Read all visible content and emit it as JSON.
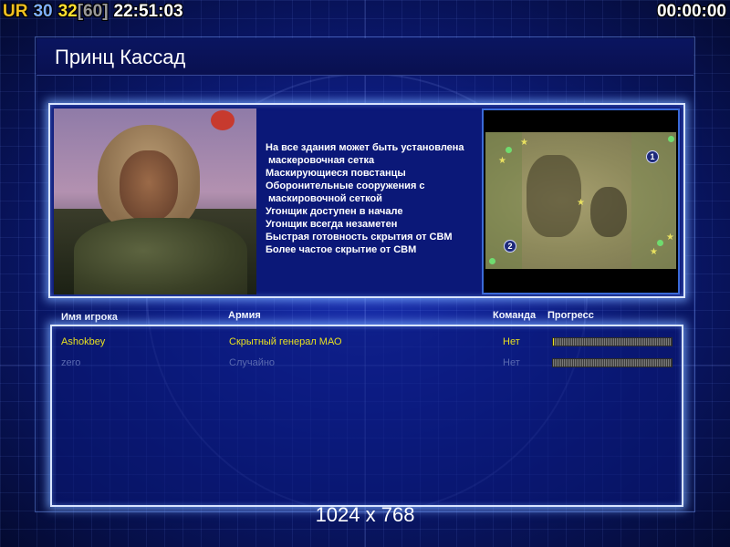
{
  "hud": {
    "ur": "UR",
    "fps": "30",
    "fps_current": "32",
    "fps_limit": "[60]",
    "clock": "22:51:03",
    "timer": "00:00:00"
  },
  "title": "Принц Кассад",
  "traits": [
    "На все здания может быть установлена",
    " маскеровочная сетка",
    "Маскирующиеся повстанцы",
    "Оборонительные сооружения с",
    " маскировочной сеткой",
    "Угонщик доступен в начале",
    "Угонщик всегда незаметен",
    "Быстрая готовность скрытия от СВМ",
    "Более частое скрытие от СВМ"
  ],
  "map": {
    "markers": [
      "1",
      "2"
    ]
  },
  "columns": {
    "player": "Имя игрока",
    "army": "Армия",
    "team": "Команда",
    "progress": "Прогресс"
  },
  "players": [
    {
      "name": "Ashokbey",
      "army": "Скрытный генерал МАО",
      "team": "Нет",
      "progress": 0.01,
      "state": "active"
    },
    {
      "name": "zero",
      "army": "Случайно",
      "team": "Нет",
      "progress": 0,
      "state": "inactive"
    }
  ],
  "resolution": "1024 x 768",
  "colors": {
    "accent_yellow": "#e8e020",
    "inactive_blue": "#5a6ab0",
    "panel_border": "#d8e4ff"
  }
}
